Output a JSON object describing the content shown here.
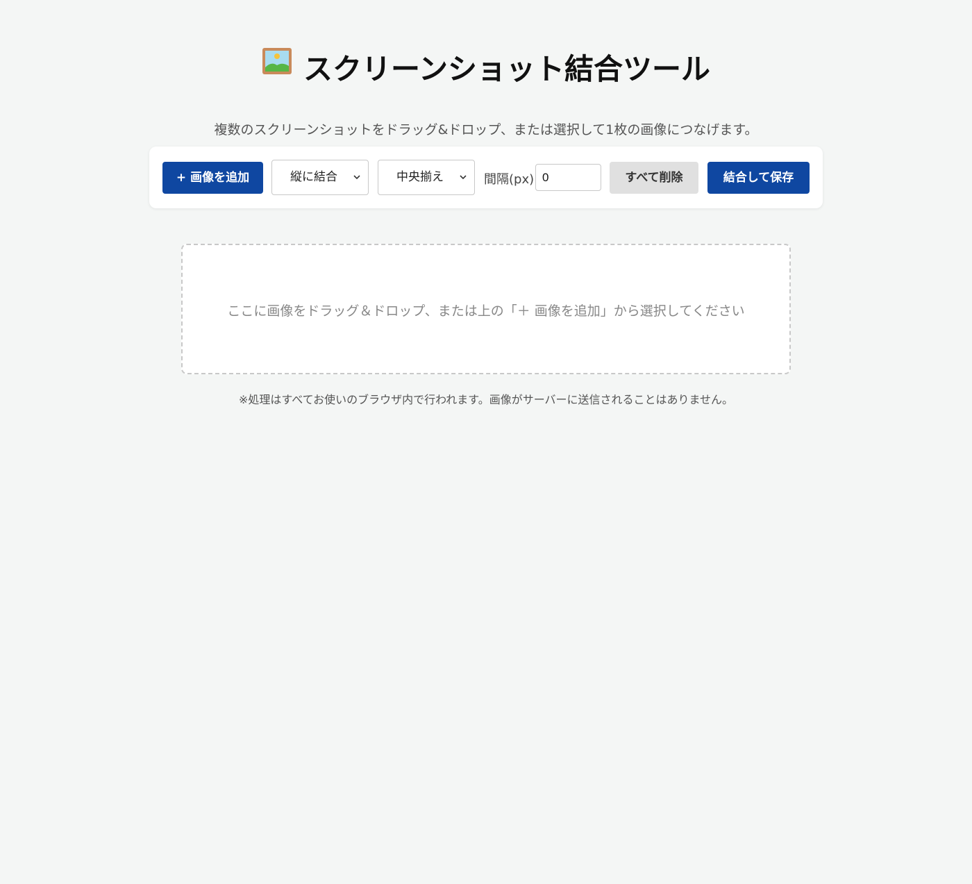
{
  "header": {
    "icon": "framed-picture-icon",
    "title": "スクリーンショット結合ツール",
    "description": "複数のスクリーンショットをドラッグ&ドロップ、または選択して1枚の画像につなげます。"
  },
  "toolbar": {
    "add_label": "+ 画像を追加",
    "direction_value": "縦に結合",
    "align_value": "中央揃え",
    "gap_label": "間隔(px)",
    "gap_value": "0",
    "clear_label": "すべて削除",
    "save_label": "結合して保存"
  },
  "drop_zone": {
    "text": "ここに画像をドラッグ＆ドロップ、または上の「＋ 画像を追加」から選択してください"
  },
  "footer": {
    "note": "※処理はすべてお使いのブラウザ内で行われます。画像がサーバーに送信されることはありません。"
  },
  "colors": {
    "background": "#f4f6f5",
    "primary": "#0f47a1",
    "secondary": "#e0e0e0"
  }
}
